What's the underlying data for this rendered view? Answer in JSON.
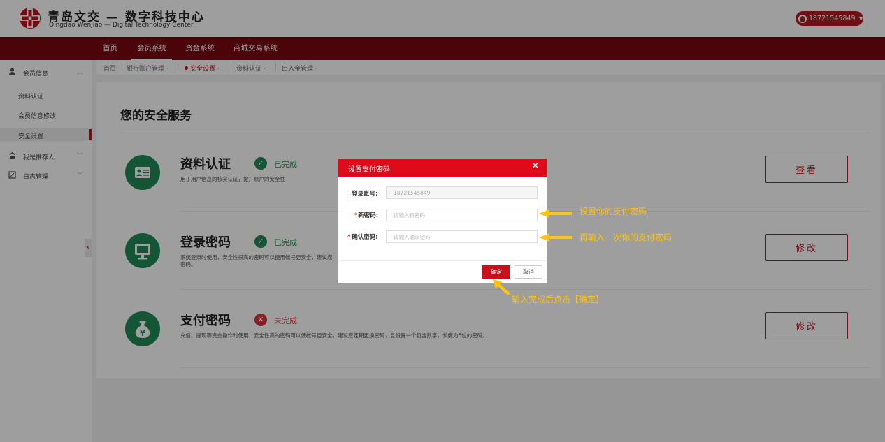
{
  "header": {
    "logo_title": "青岛文交 — 数字科技中心",
    "logo_subtitle": "Qingdao Wenjiao — Digital Technology Center",
    "user_account": "18721545849"
  },
  "nav": {
    "items": [
      "首页",
      "会员系统",
      "资金系统",
      "商城交易系统"
    ],
    "active": "会员系统"
  },
  "sidebar": {
    "member_info": "会员信息",
    "sub_items": [
      "资料认证",
      "会员信息修改",
      "安全设置"
    ],
    "active_sub": "安全设置",
    "referrer": "我是推荐人",
    "log_mgmt": "日志管理"
  },
  "breadcrumb": {
    "home": "首页",
    "items": [
      "银行账户管理",
      "安全设置",
      "资料认证",
      "出入金管理"
    ],
    "active": "安全设置"
  },
  "main": {
    "title": "您的安全服务",
    "services": [
      {
        "name": "资料认证",
        "status": "已完成",
        "status_color": "#1f8a56",
        "desc_lines": [
          "用于用户信息的核实认证，提升账户的安全性"
        ],
        "button": "查看",
        "icon": "id-card-icon"
      },
      {
        "name": "登录密码",
        "status": "已完成",
        "status_color": "#1f8a56",
        "desc_lines": [
          "系统登录时使用，安全性很高的密码可以使用帐号更安全，建议您",
          "密码。"
        ],
        "button": "修改",
        "icon": "monitor-icon"
      },
      {
        "name": "支付密码",
        "status": "未完成",
        "status_color": "#e0323c",
        "desc_lines": [
          "充值、提现等资金操作时使用，安全性高的密码可以使帐号更安全，建议您定期更换密码，且设置一个包含数字，长度为6位的密码。"
        ],
        "button": "修改",
        "icon": "money-bag-icon"
      }
    ]
  },
  "dialog": {
    "title": "设置支付密码",
    "fields": [
      {
        "label": "登录账号:",
        "required": false,
        "value": "18721545849",
        "placeholder": ""
      },
      {
        "label": "新密码:",
        "required": true,
        "value": "",
        "placeholder": "请输入新密码"
      },
      {
        "label": "确认密码:",
        "required": true,
        "value": "",
        "placeholder": "请输入确认密码"
      }
    ],
    "required_mark": "*",
    "ok_label": "确定",
    "cancel_label": "取消"
  },
  "annotations": {
    "note_new_password": "设置你的支付密码",
    "note_confirm_password": "再输入一次你的支付密码",
    "note_submit": "输入完成后点击【确定】",
    "color": "#ffc410"
  },
  "colors": {
    "brand_red": "#7a0810",
    "dialog_red": "#e00b1a",
    "success_green": "#1f8a56"
  }
}
